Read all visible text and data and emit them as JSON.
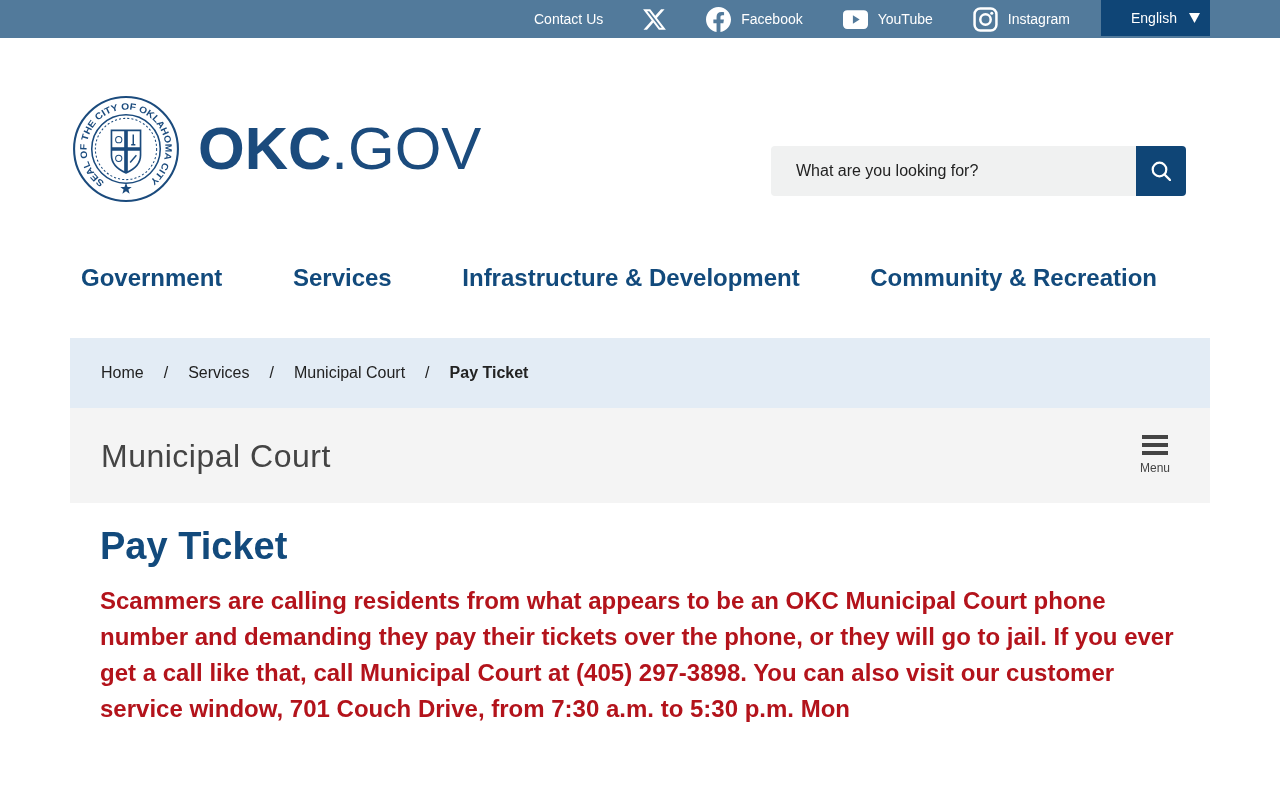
{
  "top_bar": {
    "links": [
      {
        "kind": "contact",
        "label": "Contact Us"
      },
      {
        "kind": "x"
      },
      {
        "kind": "facebook",
        "label": "Facebook"
      },
      {
        "kind": "youtube",
        "label": "YouTube"
      },
      {
        "kind": "instagram",
        "label": "Instagram"
      }
    ],
    "language": {
      "label": "English"
    }
  },
  "header": {
    "logo": {
      "seal_text": "SEAL OF THE CITY OF OKLAHOMA CITY",
      "wordmark": "**OKC**.GOV"
    },
    "search": {
      "placeholder": "What are you looking for?"
    }
  },
  "main_nav": [
    "Government",
    "Services",
    "Infrastructure & Development",
    "Community & Recreation"
  ],
  "breadcrumb": [
    {
      "kind": "link",
      "label": "Home"
    },
    {
      "kind": "separator",
      "label": "/"
    },
    {
      "kind": "link",
      "label": "Services"
    },
    {
      "kind": "separator",
      "label": "/"
    },
    {
      "kind": "link",
      "label": "Municipal Court"
    },
    {
      "kind": "separator",
      "label": "/"
    },
    {
      "kind": "current",
      "label": "Pay Ticket"
    }
  ],
  "section": {
    "title": "Municipal Court",
    "menu_button": {
      "label": "Menu"
    }
  },
  "content": {
    "heading": "Pay Ticket",
    "alert": "Scammers are calling residents from what appears to be an OKC Municipal Court phone number and demanding they pay their tickets over the phone, or they will go to jail. If you ever get a call like that, call Municipal Court at (405) 297-3898. You can also visit our customer service window, 701 Couch Drive, from 7:30 a.m. to 5:30 p.m. Mon"
  }
}
